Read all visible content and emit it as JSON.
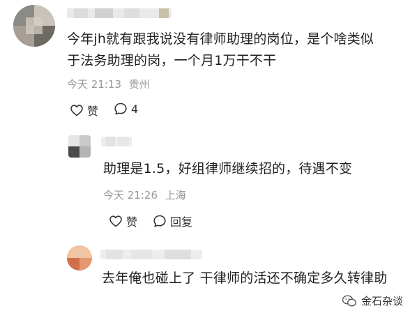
{
  "comments": [
    {
      "content": "今年jh就有跟我说没有律师助理的岗位，是个啥类似于法务助理的岗，一个月1万干不干",
      "time": "今天 21:13",
      "location": "贵州",
      "like_label": "赞",
      "reply_count": "4"
    },
    {
      "content": "助理是1.5，好组律师继续招的，待遇不变",
      "time": "今天 21:26",
      "location": "上海",
      "like_label": "赞",
      "reply_label": "回复"
    },
    {
      "content": "去年俺也碰上了 干律师的活还不确定多久转律助"
    }
  ],
  "watermark": {
    "text": "金石杂谈",
    "icon": "wechat-icon"
  },
  "colors": {
    "meta_text": "#999999",
    "body_text": "#1f1f1f",
    "icon_stroke": "#333333"
  }
}
